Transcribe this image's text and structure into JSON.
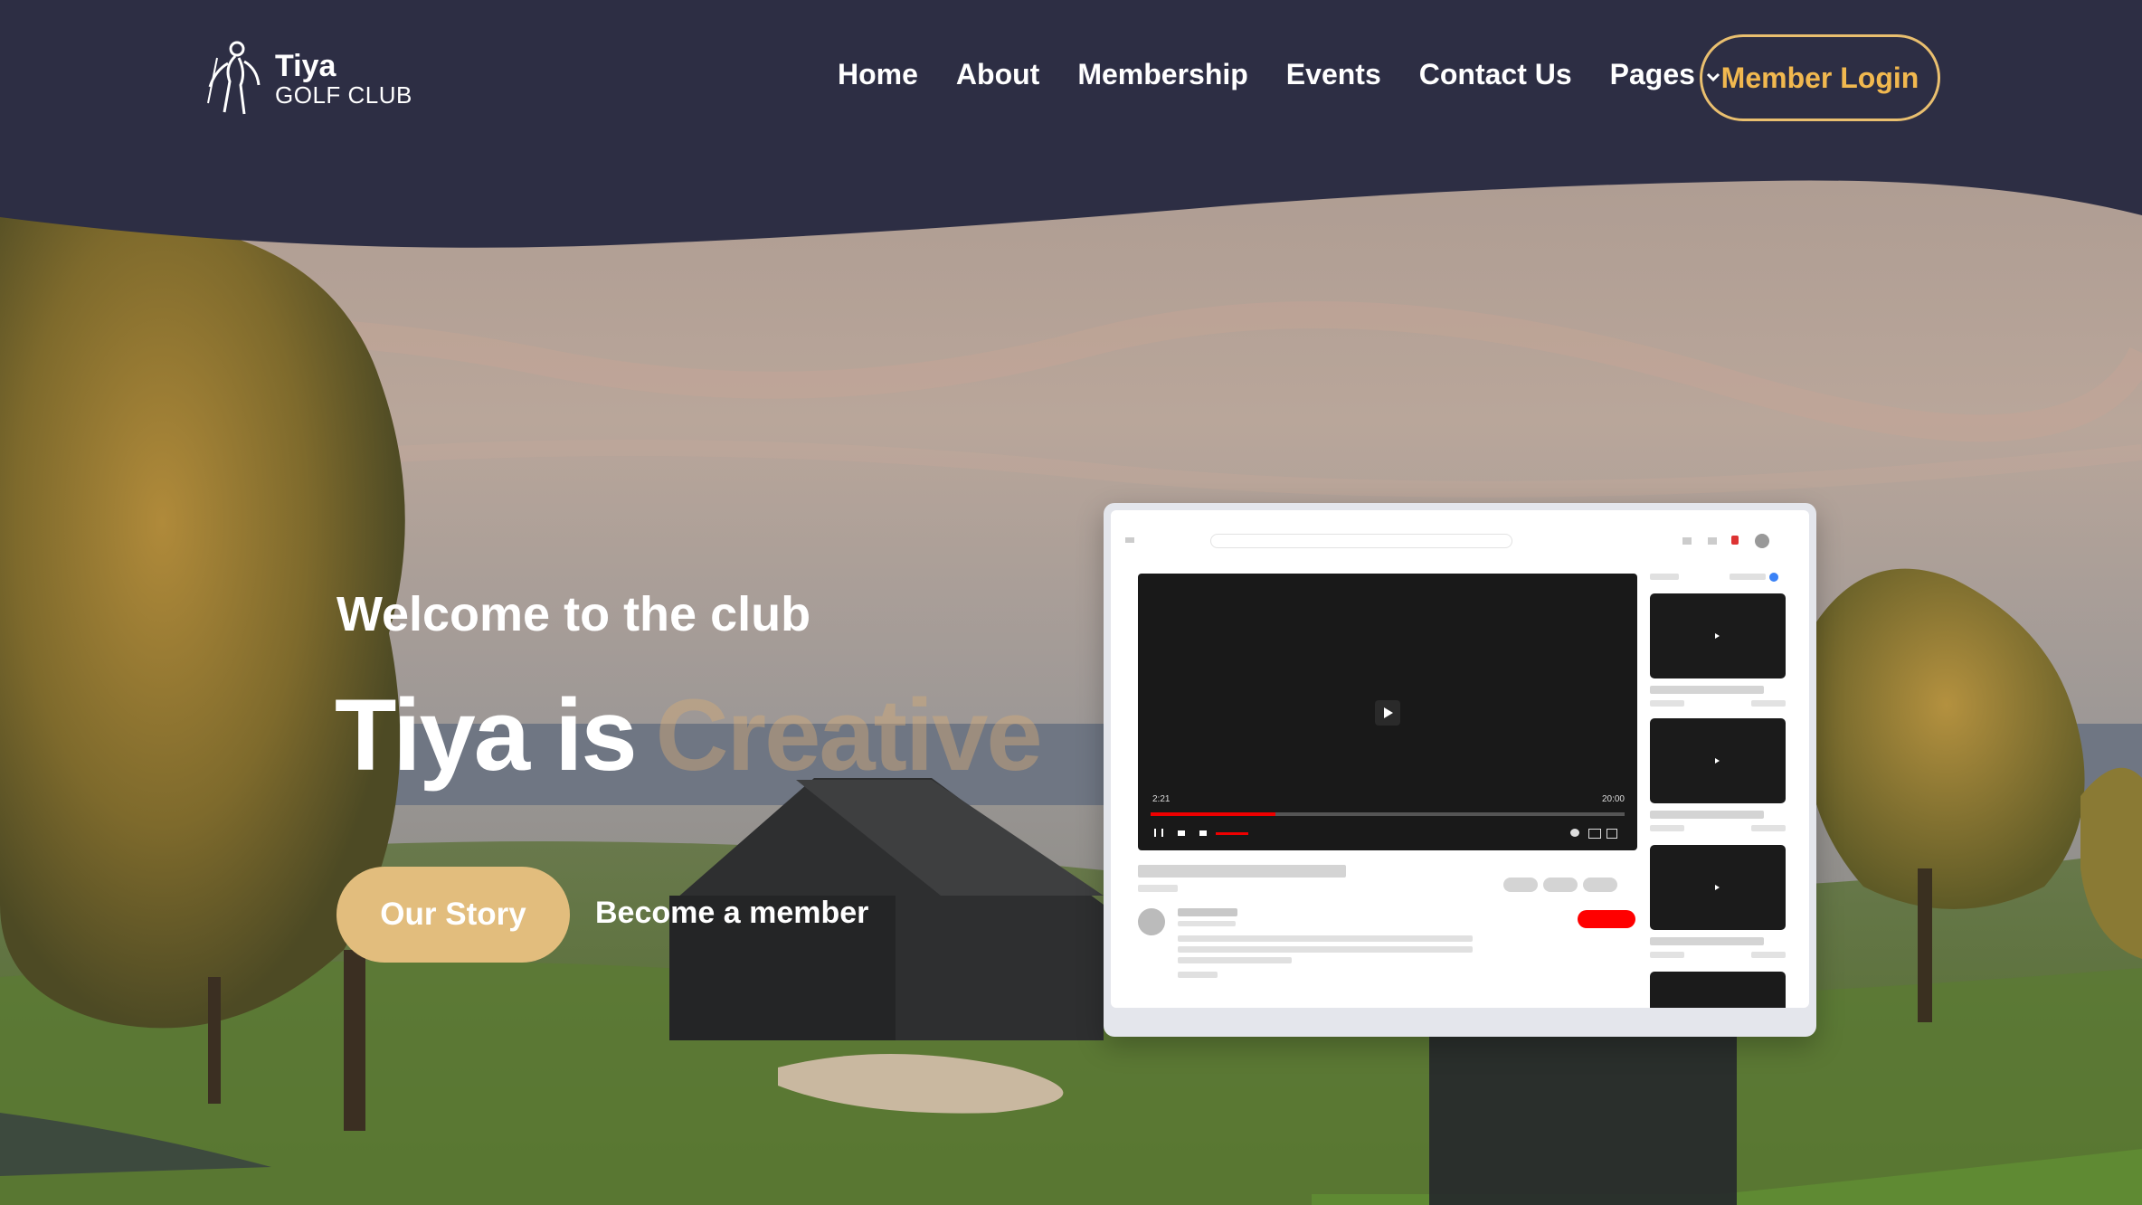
{
  "brand": {
    "name": "Tiya",
    "subtitle": "GOLF CLUB"
  },
  "nav": {
    "items": [
      "Home",
      "About",
      "Membership",
      "Events",
      "Contact Us",
      "Pages"
    ],
    "login_label": "Member Login"
  },
  "hero": {
    "welcome": "Welcome to the club",
    "headline_prefix": "Tiya is",
    "headline_rotating": "Creative",
    "primary_cta": "Our Story",
    "secondary_cta": "Become a member"
  },
  "video_mockup": {
    "time_elapsed": "2:21",
    "time_total": "20:00"
  },
  "colors": {
    "navy": "#2d2e44",
    "gold_button": "#e2bd7d",
    "gold_text": "#f1b84f",
    "gold_border": "#e9bf6f"
  }
}
